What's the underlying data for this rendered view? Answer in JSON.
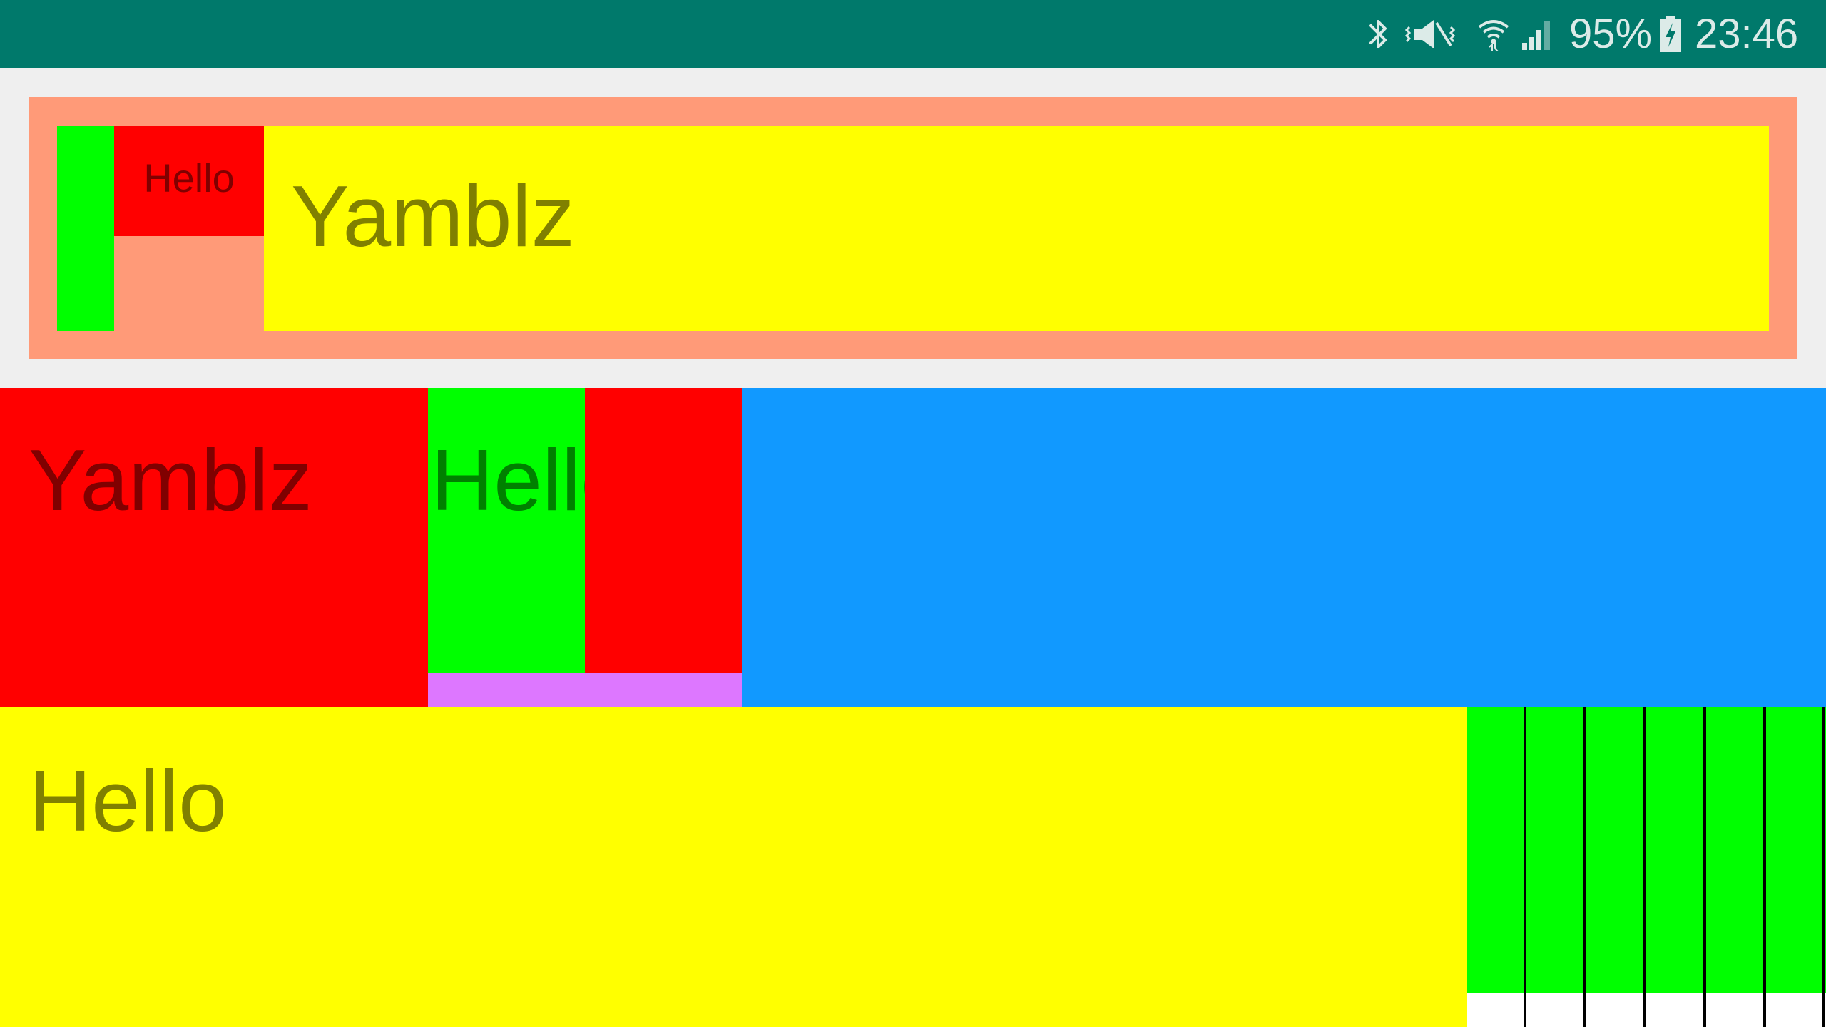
{
  "status_bar": {
    "battery_percent": "95%",
    "time": "23:46",
    "icons": [
      "bluetooth-icon",
      "vibrate-mute-icon",
      "wifi-icon",
      "cell-signal-icon",
      "battery-charging-icon"
    ],
    "background_color": "#00796B"
  },
  "top_card": {
    "small_label": "Hello",
    "title": "Yamblz",
    "colors": {
      "card": "#FF9A78",
      "green": "#00FF00",
      "red": "#FF0000",
      "yellow": "#FFFF00"
    }
  },
  "middle_row": {
    "left_label": "Yamblz",
    "center_label": "Hello",
    "colors": {
      "red": "#FF0000",
      "green": "#00FF00",
      "violet": "#DD77FF",
      "blue": "#1199FF"
    }
  },
  "bottom_row": {
    "label": "Hello",
    "colors": {
      "yellow": "#FFFF00",
      "green": "#00FF00",
      "white": "#FFFFFF",
      "stripes": "#000000"
    }
  }
}
